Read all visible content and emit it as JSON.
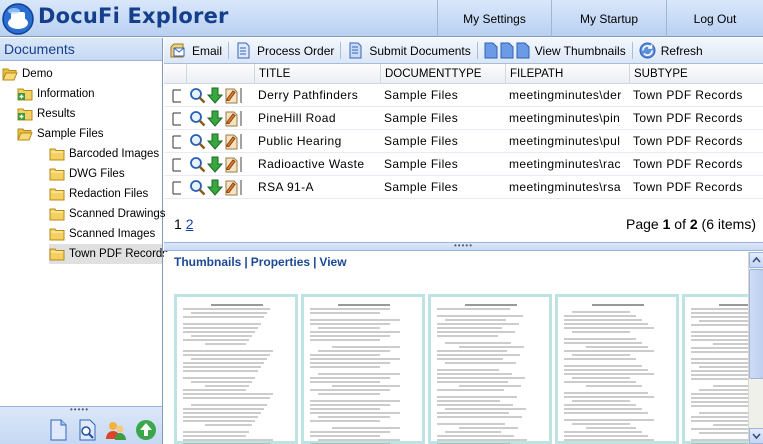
{
  "app": {
    "title": "DocuFi Explorer"
  },
  "top_nav": {
    "settings": "My Settings",
    "startup": "My Startup",
    "logout": "Log Out"
  },
  "left_panel": {
    "title": "Documents",
    "tree": [
      {
        "label": "Demo",
        "level": 0,
        "icon": "folder-open-icon"
      },
      {
        "label": "Information",
        "level": 1,
        "icon": "folder-plus-icon"
      },
      {
        "label": "Results",
        "level": 1,
        "icon": "folder-plus-icon"
      },
      {
        "label": "Sample Files",
        "level": 1,
        "icon": "folder-open-icon"
      },
      {
        "label": "Barcoded Images",
        "level": 2,
        "icon": "folder-icon"
      },
      {
        "label": "DWG Files",
        "level": 2,
        "icon": "folder-icon"
      },
      {
        "label": "Redaction Files",
        "level": 2,
        "icon": "folder-icon"
      },
      {
        "label": "Scanned Drawings",
        "level": 2,
        "icon": "folder-icon"
      },
      {
        "label": "Scanned Images",
        "level": 2,
        "icon": "folder-icon"
      },
      {
        "label": "Town PDF Records",
        "level": 2,
        "icon": "folder-icon",
        "selected": true
      }
    ]
  },
  "toolbar": {
    "email": "Email",
    "process_order": "Process Order",
    "submit_documents": "Submit Documents",
    "view_thumbnails": "View Thumbnails",
    "refresh": "Refresh"
  },
  "grid": {
    "columns": [
      "TITLE",
      "DOCUMENTTYPE",
      "FILEPATH",
      "SUBTYPE"
    ],
    "rows": [
      [
        "Derry Pathfinders",
        "Sample Files",
        "meetingminutes\\der",
        "Town PDF Records"
      ],
      [
        "PineHill Road",
        "Sample Files",
        "meetingminutes\\pin",
        "Town PDF Records"
      ],
      [
        "Public Hearing",
        "Sample Files",
        "meetingminutes\\pul",
        "Town PDF Records"
      ],
      [
        "Radioactive Waste",
        "Sample Files",
        "meetingminutes\\rac",
        "Town PDF Records"
      ],
      [
        "RSA 91-A",
        "Sample Files",
        "meetingminutes\\rsa",
        "Town PDF Records"
      ]
    ]
  },
  "pager": {
    "page_1": "1",
    "page_2": "2",
    "info_prefix": "Page ",
    "current": "1",
    "info_of": " of ",
    "total": "2",
    "info_suffix": " (6 items)"
  },
  "bottom_tabs": {
    "thumbnails": "Thumbnails",
    "properties": "Properties",
    "view": "View",
    "separator": "|"
  },
  "colors": {
    "header_bg": "#c6d9f4",
    "title_blue": "#153f8c",
    "link_blue": "#1d4894",
    "thumb_border": "#bfe3e3"
  }
}
